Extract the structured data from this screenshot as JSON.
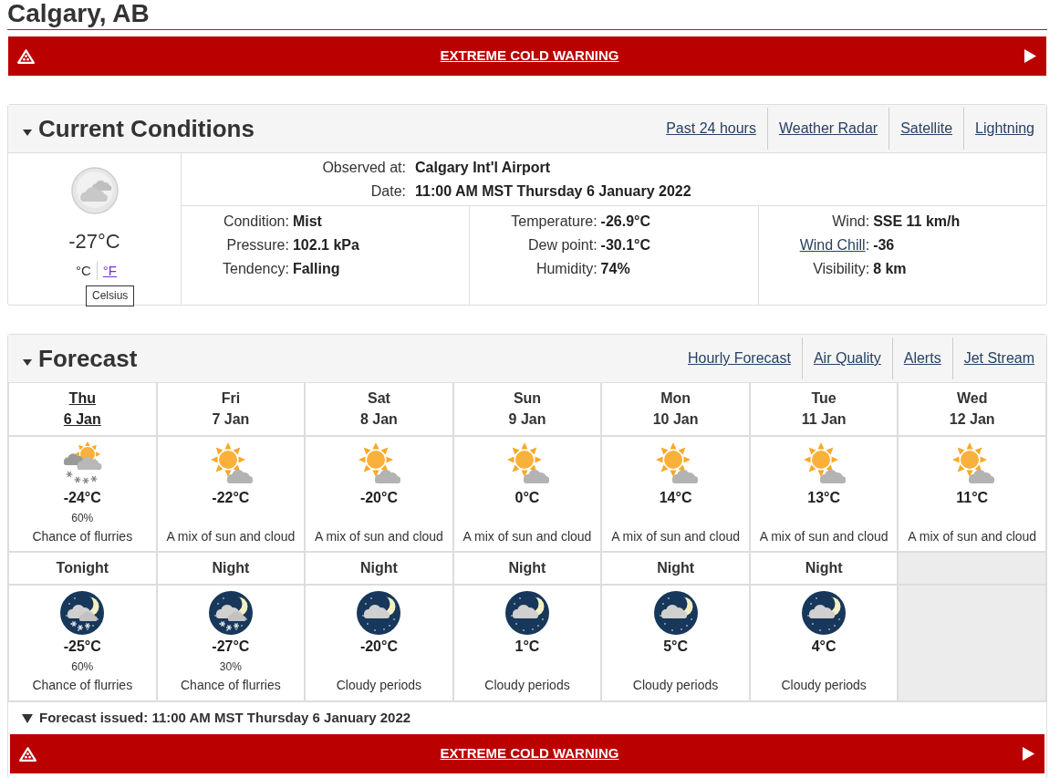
{
  "location": {
    "title": "Calgary, AB"
  },
  "warning": {
    "text": "EXTREME COLD WARNING"
  },
  "current_conditions": {
    "title": "Current Conditions",
    "expanded": true,
    "links": [
      "Past 24 hours",
      "Weather Radar",
      "Satellite",
      "Lightning"
    ],
    "temperature": "-27°C",
    "units": [
      {
        "label": "°C",
        "selected": true
      },
      {
        "label": "°F",
        "selected": false
      }
    ],
    "tooltip": "Celsius",
    "station": [
      {
        "label": "Observed at:",
        "value": "Calgary Int'l Airport"
      },
      {
        "label": "Date:",
        "value": "11:00 AM MST Thursday 6 January 2022"
      }
    ],
    "columns": [
      [
        {
          "label": "Condition:",
          "value": "Mist",
          "link": false
        },
        {
          "label": "Pressure:",
          "value": "102.1 kPa",
          "link": false
        },
        {
          "label": "Tendency:",
          "value": "Falling",
          "link": false
        }
      ],
      [
        {
          "label": "Temperature:",
          "value": "-26.9°C",
          "link": false
        },
        {
          "label": "Dew point:",
          "value": "-30.1°C",
          "link": false
        },
        {
          "label": "Humidity:",
          "value": "74%",
          "link": false
        }
      ],
      [
        {
          "label": "Wind:",
          "value": "SSE 11 km/h",
          "link": false
        },
        {
          "label": "Wind Chill",
          "suffix": ":",
          "value": "-36",
          "link": true
        },
        {
          "label": "Visibility:",
          "value": "8 km",
          "link": false
        }
      ]
    ]
  },
  "forecast": {
    "title": "Forecast",
    "expanded": true,
    "links": [
      "Hourly Forecast",
      "Air Quality",
      "Alerts",
      "Jet Stream"
    ],
    "days": [
      {
        "day": "Thu",
        "date": "6 Jan",
        "selected": true,
        "kind": "sun-snow",
        "temp": "-24°C",
        "pop": "60%",
        "summary": "Chance of flurries"
      },
      {
        "day": "Fri",
        "date": "7 Jan",
        "selected": false,
        "kind": "sun-cloud",
        "temp": "-22°C",
        "summary": "A mix of sun and cloud"
      },
      {
        "day": "Sat",
        "date": "8 Jan",
        "selected": false,
        "kind": "sun-cloud",
        "temp": "-20°C",
        "summary": "A mix of sun and cloud"
      },
      {
        "day": "Sun",
        "date": "9 Jan",
        "selected": false,
        "kind": "sun-cloud",
        "temp": "0°C",
        "summary": "A mix of sun and cloud"
      },
      {
        "day": "Mon",
        "date": "10 Jan",
        "selected": false,
        "kind": "sun-cloud",
        "temp": "14°C",
        "summary": "A mix of sun and cloud"
      },
      {
        "day": "Tue",
        "date": "11 Jan",
        "selected": false,
        "kind": "sun-cloud",
        "temp": "13°C",
        "summary": "A mix of sun and cloud"
      },
      {
        "day": "Wed",
        "date": "12 Jan",
        "selected": false,
        "kind": "sun-cloud",
        "temp": "11°C",
        "summary": "A mix of sun and cloud"
      }
    ],
    "nights": [
      {
        "label": "Tonight",
        "kind": "moon-snow",
        "temp": "-25°C",
        "pop": "60%",
        "summary": "Chance of flurries"
      },
      {
        "label": "Night",
        "kind": "moon-snow",
        "temp": "-27°C",
        "pop": "30%",
        "summary": "Chance of flurries"
      },
      {
        "label": "Night",
        "kind": "moon-cloud",
        "temp": "-20°C",
        "summary": "Cloudy periods"
      },
      {
        "label": "Night",
        "kind": "moon-cloud",
        "temp": "1°C",
        "summary": "Cloudy periods"
      },
      {
        "label": "Night",
        "kind": "moon-cloud",
        "temp": "5°C",
        "summary": "Cloudy periods"
      },
      {
        "label": "Night",
        "kind": "moon-cloud",
        "temp": "4°C",
        "summary": "Cloudy periods"
      }
    ],
    "issued": {
      "text": "Forecast issued: 11:00 AM MST Thursday 6 January 2022",
      "expanded": true
    },
    "warning": {
      "text": "EXTREME COLD WARNING"
    }
  }
}
